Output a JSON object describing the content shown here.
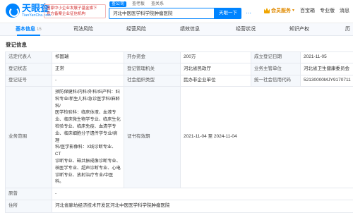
{
  "header": {
    "logo_cn": "天眼查",
    "logo_en": "TianYanCha.com",
    "gov_badge_line1": "国家中小企业发展子基金旗下",
    "gov_badge_line2": "官方备案企业征信机构",
    "search_tabs": [
      "查公司",
      "查老板",
      "查关系"
    ],
    "search_value": "河北中医医学科学院肿瘤医院",
    "search_button": "天眼一下",
    "vip_label": "会员服务",
    "links": [
      "百宝箱",
      "专业版",
      "消息"
    ]
  },
  "tabs": [
    {
      "label": "基本信息",
      "count": "15"
    },
    {
      "label": "司法风险",
      "count": ""
    },
    {
      "label": "经营风险",
      "count": ""
    },
    {
      "label": "绩效信息",
      "count": ""
    },
    {
      "label": "经营状况",
      "count": ""
    },
    {
      "label": "知识产权",
      "count": ""
    },
    {
      "label": "历",
      "count": ""
    }
  ],
  "section_title": "登记信息",
  "info": {
    "legal_rep_label": "法定代表人",
    "legal_rep_value": "祁国瑞",
    "capital_label": "开办资金",
    "capital_value": "200万",
    "est_date_label": "成立登记日期",
    "est_date_value": "2021-11-05",
    "status_label": "登记状态",
    "status_value": "正常",
    "authority_label": "登记管理机关",
    "authority_value": "河北省民政厅",
    "supervisor_label": "业务主管单位",
    "supervisor_value": "河北省卫生健康委员会",
    "cert_label": "登记证号",
    "cert_value": "-",
    "org_type_label": "社会组织类型",
    "org_type_value": "民办非企业单位",
    "credit_code_label": "统一社会信用代码",
    "credit_code_value": "52130000MJY9170711",
    "scope_label": "业务范围",
    "scope_lines": [
      "预防保健科/内科/外科/妇产科：妇",
      "科专业/新生儿科/急诊医学科/麻醉科/",
      "医学检验科：临床体液、血液专",
      "业、临床微生物学专业、临床生化",
      "检验专业、临床免疫、血清学专",
      "业、临床细胞分子遗传学专业/病理",
      "科/医学影像科：X线诊断专业、CT",
      "诊断专业、磁共振成像诊断专业、",
      "核医学专业、超声诊断专业、心电",
      "诊断专业、放射治疗专业/中医科。"
    ],
    "validity_label": "证书有效期",
    "validity_value": "2021-11-04 至 2024-11-04",
    "former_name_label": "原曾",
    "former_name_value": "-",
    "address_label": "住所",
    "address_value": "河北省廊坊经济技术开发区河北中医医学科学院肿瘤医院"
  }
}
